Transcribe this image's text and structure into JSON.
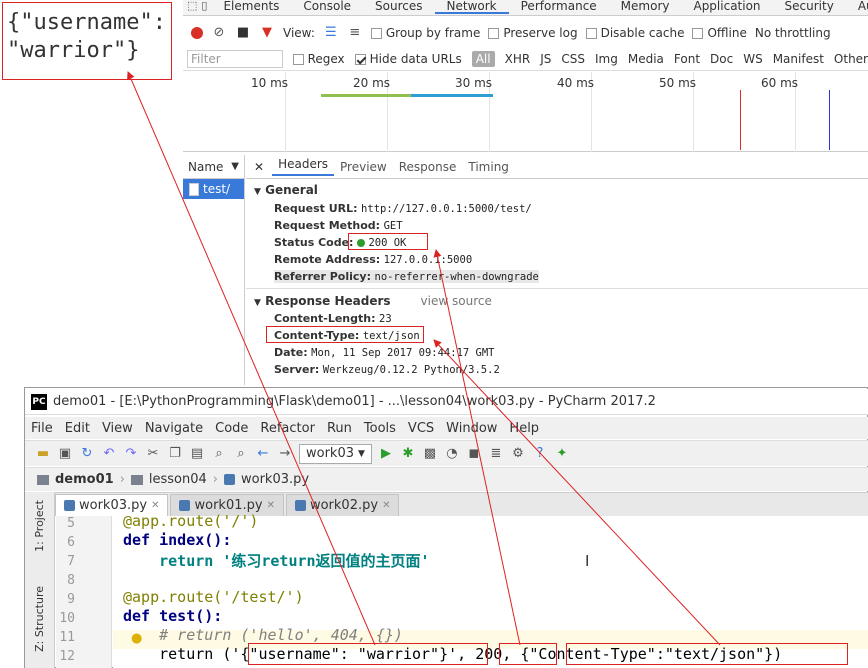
{
  "note": {
    "line1": "{\"username\":",
    "line2": "\"warrior\"}"
  },
  "devtools": {
    "tabs": [
      "Elements",
      "Console",
      "Sources",
      "Network",
      "Performance",
      "Memory",
      "Application",
      "Security",
      "Audits"
    ],
    "active_tab": "Network",
    "toolbar": {
      "view_label": "View:",
      "group_by_frame": "Group by frame",
      "preserve_log": "Preserve log",
      "disable_cache": "Disable cache",
      "offline": "Offline",
      "throttling": "No throttling"
    },
    "filter": {
      "placeholder": "Filter",
      "regex": "Regex",
      "hide_data_urls": "Hide data URLs",
      "all": "All",
      "types": [
        "XHR",
        "JS",
        "CSS",
        "Img",
        "Media",
        "Font",
        "Doc",
        "WS",
        "Manifest",
        "Other"
      ]
    },
    "timeline_ticks": [
      "10 ms",
      "20 ms",
      "30 ms",
      "40 ms",
      "50 ms",
      "60 ms"
    ],
    "name_header": "Name",
    "request_name": "test/",
    "detail_tabs": [
      "Headers",
      "Preview",
      "Response",
      "Timing"
    ],
    "general": {
      "title": "General",
      "request_url_k": "Request URL:",
      "request_url_v": "http://127.0.0.1:5000/test/",
      "method_k": "Request Method:",
      "method_v": "GET",
      "status_k": "Status Code:",
      "status_v": "200 OK",
      "remote_k": "Remote Address:",
      "remote_v": "127.0.0.1:5000",
      "referrer_k": "Referrer Policy:",
      "referrer_v": "no-referrer-when-downgrade"
    },
    "response_headers": {
      "title": "Response Headers",
      "view_source": "view source",
      "length_k": "Content-Length:",
      "length_v": "23",
      "type_k": "Content-Type:",
      "type_v": "text/json",
      "date_k": "Date:",
      "date_v": "Mon, 11 Sep 2017 09:44:17 GMT",
      "server_k": "Server:",
      "server_v": "Werkzeug/0.12.2 Python/3.5.2"
    }
  },
  "pycharm": {
    "title": "demo01 - [E:\\PythonProgramming\\Flask\\demo01] - ...\\lesson04\\work03.py - PyCharm 2017.2",
    "menu": [
      "File",
      "Edit",
      "View",
      "Navigate",
      "Code",
      "Refactor",
      "Run",
      "Tools",
      "VCS",
      "Window",
      "Help"
    ],
    "run_config": "work03",
    "breadcrumb": [
      "demo01",
      "lesson04",
      "work03.py"
    ],
    "tabs": [
      "work03.py",
      "work01.py",
      "work02.py"
    ],
    "side_labels": [
      "1: Project",
      "Z: Structure"
    ],
    "lines": [
      {
        "n": "5",
        "text": "@app.route('/')"
      },
      {
        "n": "6",
        "text": "def index():"
      },
      {
        "n": "7",
        "text": "    return '练习return返回值的主页面'"
      },
      {
        "n": "8",
        "text": ""
      },
      {
        "n": "9",
        "text": "@app.route('/test/')"
      },
      {
        "n": "10",
        "text": "def test():"
      },
      {
        "n": "11",
        "text": "    # return ('hello', 404, {})"
      },
      {
        "n": "12",
        "text": "    return ('{\"username\": \"warrior\"}', 200, {\"Content-Type\":\"text/json\"})"
      }
    ]
  },
  "colors": {
    "annotation": "#dd2222",
    "accent": "#3879d9"
  }
}
